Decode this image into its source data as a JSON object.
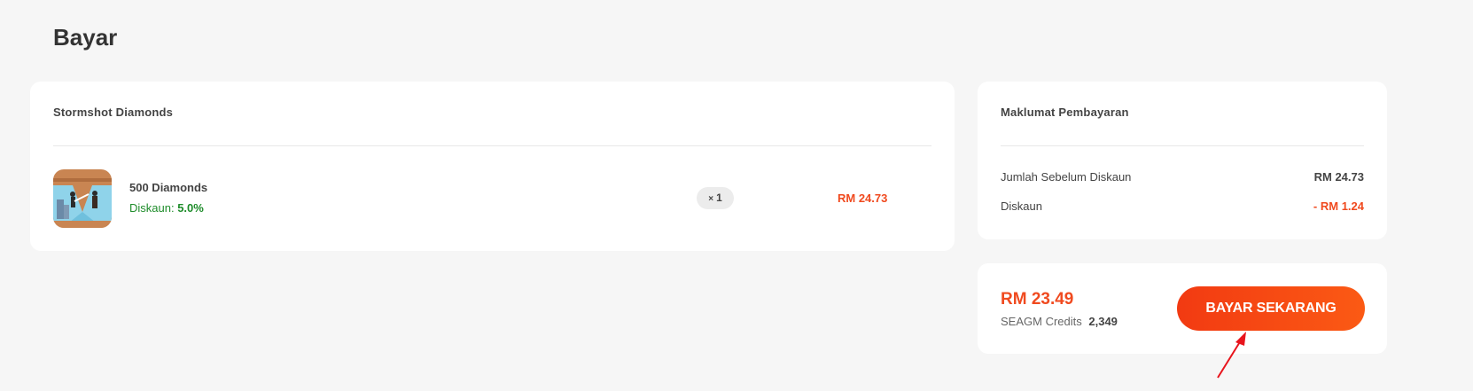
{
  "page": {
    "title": "Bayar"
  },
  "order": {
    "title": "Stormshot Diamonds",
    "item": {
      "name": "500 Diamonds",
      "discount_label": "Diskaun:",
      "discount_value": "5.0%",
      "qty_prefix": "×",
      "qty": "1",
      "price": "RM 24.73"
    }
  },
  "payment_info": {
    "title": "Maklumat Pembayaran",
    "subtotal_label": "Jumlah Sebelum Diskaun",
    "subtotal_value": "RM 24.73",
    "discount_label": "Diskaun",
    "discount_value": "- RM 1.24"
  },
  "pay": {
    "total": "RM 23.49",
    "credits_label": "SEAGM Credits",
    "credits_value": "2,349",
    "button_label": "BAYAR SEKARANG"
  },
  "colors": {
    "accent": "#f04a1f",
    "discount_green": "#1e8c2a",
    "annotation_arrow": "#e8141c"
  }
}
